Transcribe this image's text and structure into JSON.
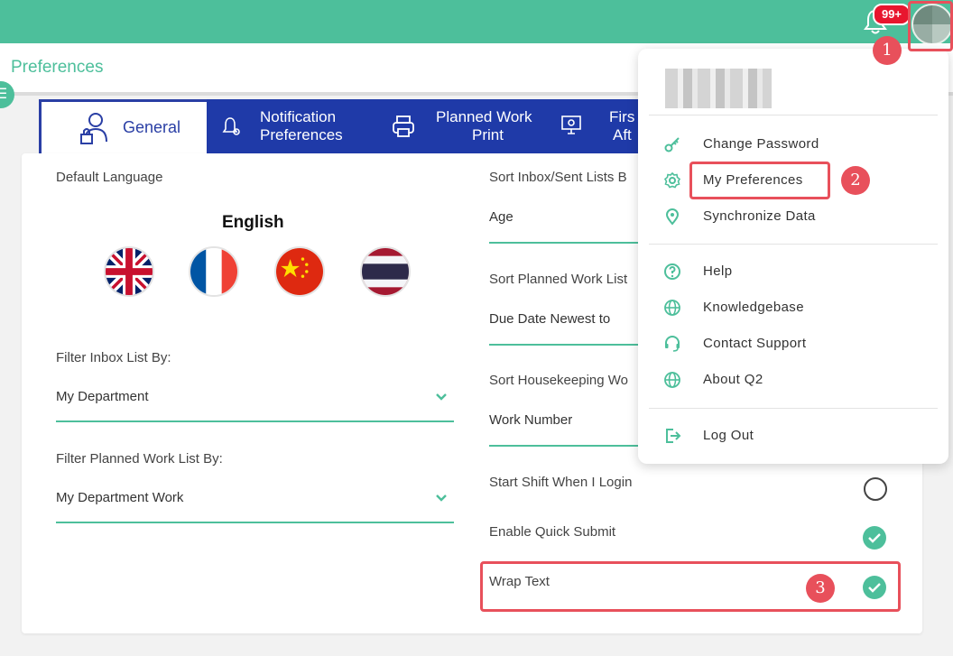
{
  "header": {
    "notification_badge": "99+"
  },
  "page": {
    "title": "Preferences"
  },
  "tabs": [
    {
      "label_line1": "General",
      "label_line2": ""
    },
    {
      "label_line1": "Notification",
      "label_line2": "Preferences"
    },
    {
      "label_line1": "Planned Work",
      "label_line2": "Print"
    },
    {
      "label_line1": "Firs",
      "label_line2": "Aft"
    }
  ],
  "left": {
    "default_language_label": "Default Language",
    "selected_language": "English",
    "flags": [
      "uk-flag",
      "france-flag",
      "china-flag",
      "thailand-flag"
    ],
    "filter_inbox_label": "Filter Inbox List By:",
    "filter_inbox_value": "My Department",
    "filter_planned_label": "Filter Planned Work List By:",
    "filter_planned_value": "My Department Work"
  },
  "right": {
    "sort_inbox_label": "Sort Inbox/Sent Lists B",
    "sort_inbox_value": "Age",
    "sort_planned_label": "Sort Planned Work List",
    "sort_planned_value": "Due Date Newest to",
    "sort_housekeeping_label": "Sort Housekeeping Wo",
    "sort_housekeeping_value": "Work Number",
    "start_shift_label": "Start Shift When I Login",
    "start_shift_checked": false,
    "quick_submit_label": "Enable Quick Submit",
    "quick_submit_checked": true,
    "wrap_text_label": "Wrap Text",
    "wrap_text_checked": true
  },
  "user_menu": {
    "items_group1": [
      "Change Password",
      "My Preferences",
      "Synchronize Data"
    ],
    "items_group2": [
      "Help",
      "Knowledgebase",
      "Contact Support",
      "About Q2"
    ],
    "items_group3": [
      "Log Out"
    ]
  },
  "annotations": [
    "1",
    "2",
    "3"
  ],
  "colors": {
    "accent": "#4dbf9b",
    "tab_bar": "#1f3aa8",
    "annotation": "#e8505b",
    "badge": "#e8162e"
  }
}
